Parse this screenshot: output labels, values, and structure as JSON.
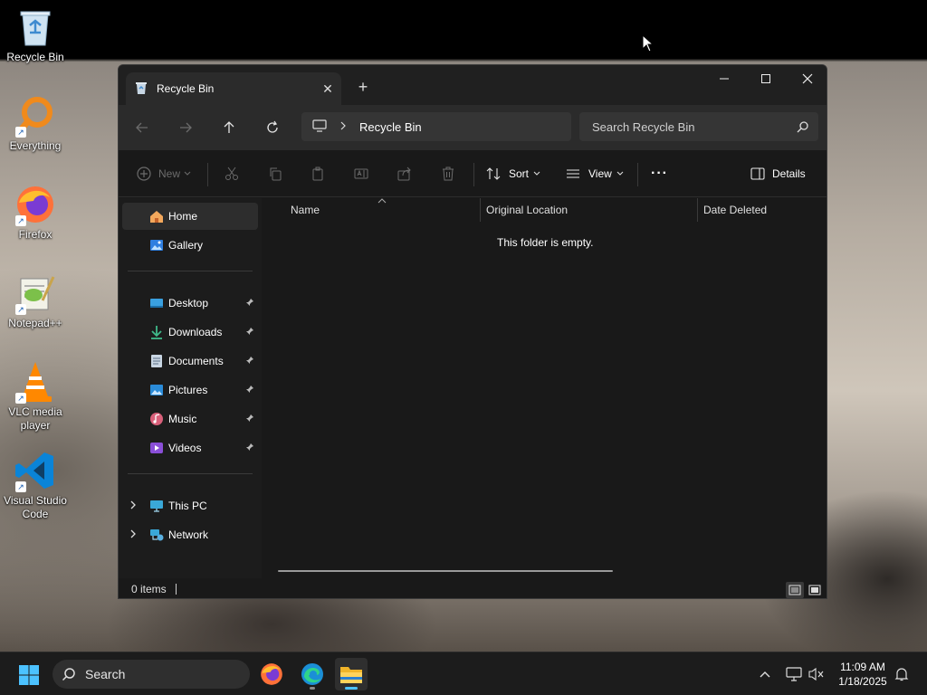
{
  "desktop": {
    "icons": [
      {
        "label": "Recycle Bin"
      },
      {
        "label": "Everything"
      },
      {
        "label": "Firefox"
      },
      {
        "label": "Notepad++"
      },
      {
        "label": "VLC media player"
      },
      {
        "label": "Visual Studio Code"
      }
    ]
  },
  "window": {
    "tab_title": "Recycle Bin",
    "tab_close": "✕",
    "new_tab": "+",
    "address": {
      "path": "Recycle Bin"
    },
    "search": {
      "placeholder": "Search Recycle Bin"
    },
    "toolbar": {
      "new_label": "New",
      "sort_label": "Sort",
      "view_label": "View",
      "more_label": "···",
      "details_label": "Details"
    },
    "sidebar": {
      "top": [
        {
          "label": "Home",
          "selected": true
        },
        {
          "label": "Gallery"
        }
      ],
      "pinned": [
        {
          "label": "Desktop"
        },
        {
          "label": "Downloads"
        },
        {
          "label": "Documents"
        },
        {
          "label": "Pictures"
        },
        {
          "label": "Music"
        },
        {
          "label": "Videos"
        }
      ],
      "bottom": [
        {
          "label": "This PC"
        },
        {
          "label": "Network"
        }
      ]
    },
    "columns": [
      "Name",
      "Original Location",
      "Date Deleted"
    ],
    "empty_message": "This folder is empty.",
    "status": {
      "item_count": "0 items"
    }
  },
  "taskbar": {
    "search_label": "Search",
    "time": "11:09 AM",
    "date": "1/18/2025"
  },
  "colors": {
    "accent": "#4cc2ff",
    "window_bg": "#191919",
    "titlebar_bg": "#202020",
    "taskbar_bg": "#1c1c1c"
  }
}
